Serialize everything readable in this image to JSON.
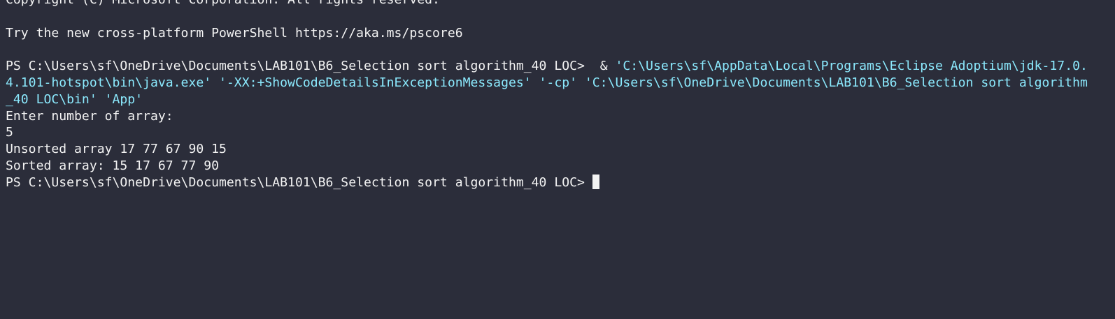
{
  "terminal": {
    "copyright": "Copyright (C) Microsoft Corporation. All rights reserved.",
    "try_line": "Try the new cross-platform PowerShell https://aka.ms/pscore6",
    "prompt_1": "PS C:\\Users\\sf\\OneDrive\\Documents\\LAB101\\B6_Selection sort algorithm_40 LOC>  ",
    "amp": "& ",
    "cmd_part_1": "'C:\\Users\\sf\\AppData\\Local\\Programs\\Eclipse Adoptium\\jdk-17.0.",
    "cmd_part_2": "4.101-hotspot\\bin\\java.exe' '-XX:+ShowCodeDetailsInExceptionMessages' '-cp' 'C:\\Users\\sf\\OneDrive\\Documents\\LAB101\\B6_Selection sort algorithm",
    "cmd_part_3": "_40 LOC\\bin' 'App'",
    "output_enter": "Enter number of array:",
    "output_input": "5",
    "output_unsorted": "Unsorted array 17 77 67 90 15",
    "output_sorted": "Sorted array: 15 17 67 77 90",
    "prompt_2": "PS C:\\Users\\sf\\OneDrive\\Documents\\LAB101\\B6_Selection sort algorithm_40 LOC> "
  },
  "colors": {
    "background": "#2b2d3a",
    "text": "#f3f3f3",
    "command_args": "#8be9fd"
  }
}
